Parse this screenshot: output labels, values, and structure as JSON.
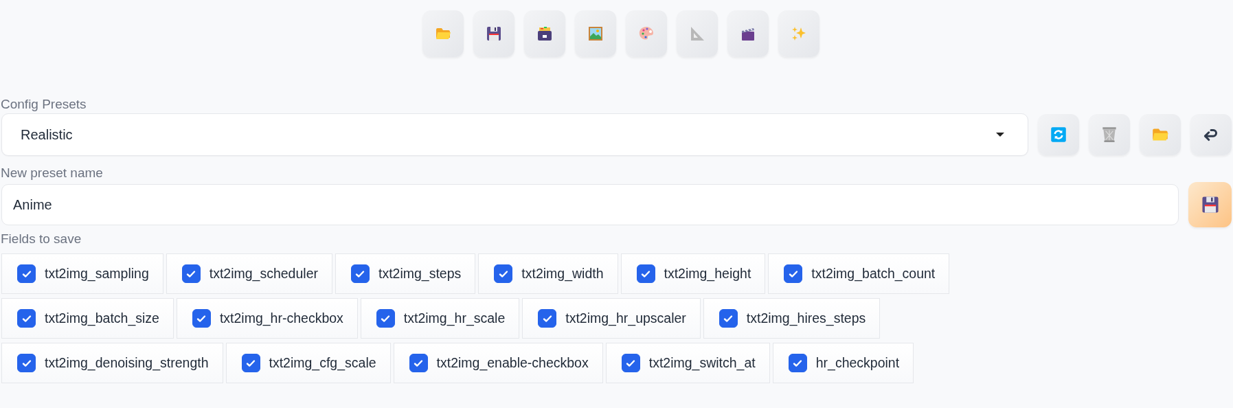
{
  "toolbar": [
    {
      "kind": "folder"
    },
    {
      "kind": "floppy"
    },
    {
      "kind": "cabinet"
    },
    {
      "kind": "framed-picture"
    },
    {
      "kind": "palette"
    },
    {
      "kind": "set-square"
    },
    {
      "kind": "clapper"
    },
    {
      "kind": "sparkles"
    }
  ],
  "config_presets": {
    "label": "Config Presets",
    "value": "Realistic",
    "buttons": [
      {
        "kind": "refresh"
      },
      {
        "kind": "trash"
      },
      {
        "kind": "folder"
      },
      {
        "kind": "return"
      }
    ]
  },
  "new_preset": {
    "label": "New preset name",
    "value": "Anime",
    "button": {
      "kind": "floppy"
    }
  },
  "fields_to_save": {
    "label": "Fields to save",
    "fields": [
      {
        "label": "txt2img_sampling",
        "checked": true
      },
      {
        "label": "txt2img_scheduler",
        "checked": true
      },
      {
        "label": "txt2img_steps",
        "checked": true
      },
      {
        "label": "txt2img_width",
        "checked": true
      },
      {
        "label": "txt2img_height",
        "checked": true
      },
      {
        "label": "txt2img_batch_count",
        "checked": true
      },
      {
        "label": "txt2img_batch_size",
        "checked": true
      },
      {
        "label": "txt2img_hr-checkbox",
        "checked": true
      },
      {
        "label": "txt2img_hr_scale",
        "checked": true
      },
      {
        "label": "txt2img_hr_upscaler",
        "checked": true
      },
      {
        "label": "txt2img_hires_steps",
        "checked": true
      },
      {
        "label": "txt2img_denoising_strength",
        "checked": true
      },
      {
        "label": "txt2img_cfg_scale",
        "checked": true
      },
      {
        "label": "txt2img_enable-checkbox",
        "checked": true
      },
      {
        "label": "txt2img_switch_at",
        "checked": true
      },
      {
        "label": "hr_checkpoint",
        "checked": true
      }
    ]
  }
}
